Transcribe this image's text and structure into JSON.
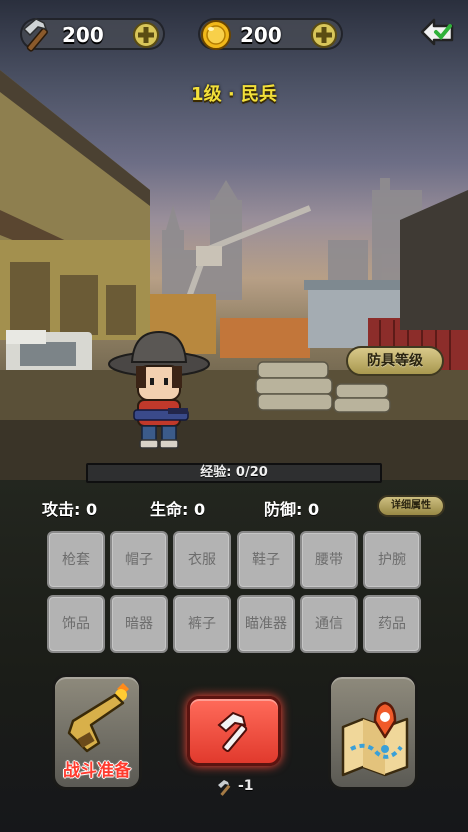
{
  "resources": {
    "hammer": {
      "icon": "hammer-icon",
      "value": "200"
    },
    "gold": {
      "icon": "gold-coin-icon",
      "value": "200"
    }
  },
  "rank_title": "1级 · 民兵",
  "armor_level_label": "防具等级",
  "experience": {
    "text": "经验: 0/20",
    "progress": 0.0
  },
  "stats": {
    "attack": "攻击: 0",
    "hp": "生命: 0",
    "defense": "防御: 0"
  },
  "detail_button_label": "详细属性",
  "equipment_slots": [
    "枪套",
    "帽子",
    "衣服",
    "鞋子",
    "腰带",
    "护腕",
    "饰品",
    "暗器",
    "裤子",
    "瞄准器",
    "通信",
    "药品"
  ],
  "battle_prep_label": "战斗准备",
  "craft_cost": "-1",
  "colors": {
    "accent_yellow": "#f3e03a",
    "craft_red": "#e13a2d",
    "battle_label_red": "#ff3b2e",
    "slot_gray": "#b3b3b3"
  }
}
